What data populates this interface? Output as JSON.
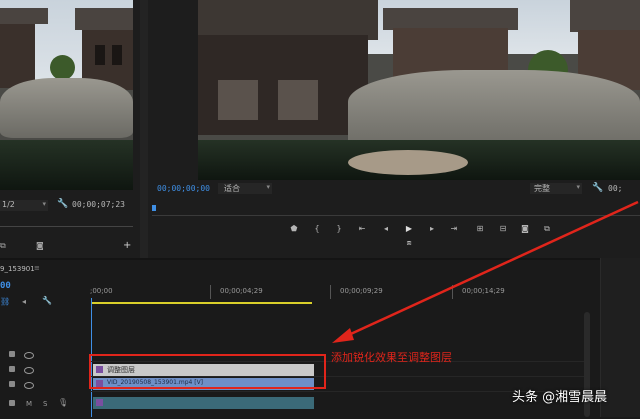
{
  "source_monitor": {
    "timecode": "00;00;07;23",
    "scale": "1/2"
  },
  "program_monitor": {
    "timecode": "00;00;00;00",
    "fit_option": "适合",
    "quality_option": "完整",
    "play_icons": [
      "marker-icon",
      "in-point-icon",
      "out-point-icon",
      "go-to-in-icon",
      "step-back-icon",
      "play-icon",
      "step-forward-icon",
      "go-to-out-icon",
      "lift-icon",
      "extract-icon",
      "export-frame-icon",
      "compare-icon"
    ]
  },
  "timeline": {
    "sequence_name": "9_153901",
    "timecode": "00",
    "ruler_labels": [
      ";00;00",
      "00;00;04;29",
      "00;00;09;29",
      "00;00;14;29"
    ],
    "clips": {
      "adjustment_layer": "调整图层",
      "video_clip": "VID_20190508_153901.mp4 [V]"
    }
  },
  "annotation": {
    "text": "添加锐化效果至调整图层",
    "color": "#e0251b"
  },
  "watermark": {
    "prefix": "头条",
    "handle": "@湘雪晨晨"
  },
  "colors": {
    "accent_blue": "#3f8fe5",
    "playhead_yellow": "#d9cf2a"
  }
}
